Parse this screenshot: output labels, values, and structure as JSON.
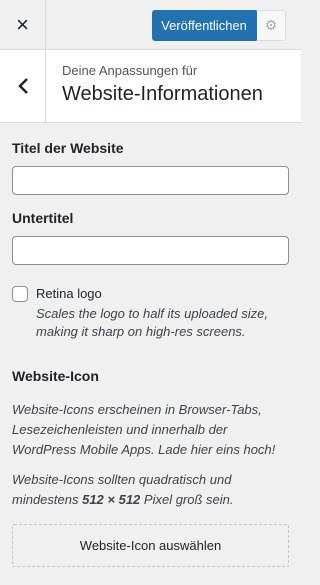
{
  "topbar": {
    "close_icon": "×",
    "publish_label": "Veröffentlichen",
    "gear_icon": "⚙"
  },
  "header": {
    "back_icon": "‹",
    "subtitle": "Deine Anpassungen für",
    "title": "Website-Informationen"
  },
  "fields": {
    "site_title_label": "Titel der Website",
    "site_title_value": "",
    "tagline_label": "Untertitel",
    "tagline_value": ""
  },
  "retina": {
    "checked": false,
    "label": "Retina logo",
    "description": "Scales the logo to half its uploaded size, making it sharp on high-res screens."
  },
  "site_icon": {
    "title": "Website-Icon",
    "desc1": "Website-Icons erscheinen in Browser-Tabs, Lesezeichenleisten und innerhalb der WordPress Mobile Apps. Lade hier eins hoch!",
    "desc2_before": "Website-Icons sollten quadratisch und mindestens ",
    "desc2_size": "512 × 512",
    "desc2_after": " Pixel groß sein.",
    "button_label": "Website-Icon auswählen"
  },
  "colors": {
    "accent": "#2271b1",
    "background": "#f0f0f1"
  }
}
